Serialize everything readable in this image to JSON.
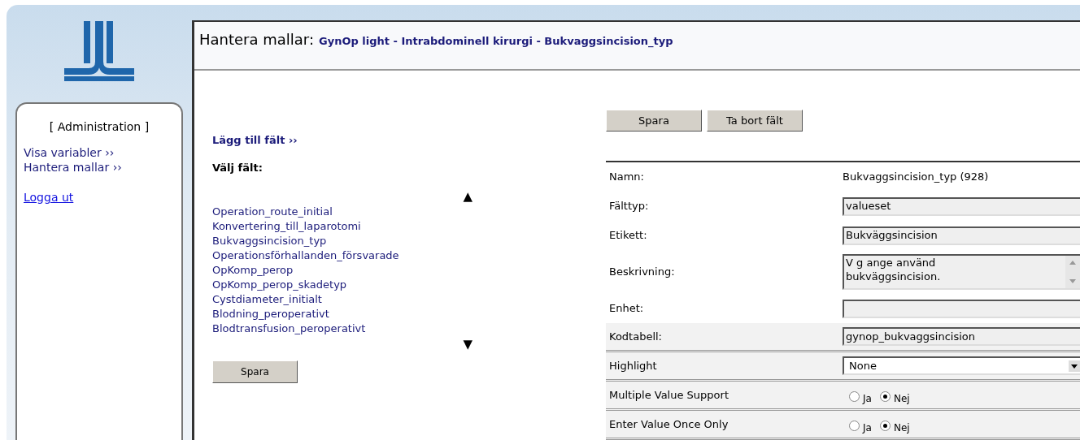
{
  "sidebar": {
    "heading": "[ Administration ]",
    "links": [
      {
        "label": "Visa variabler ››"
      },
      {
        "label": "Hantera mallar ››"
      }
    ],
    "logout": "Logga ut"
  },
  "header": {
    "title": "Hantera mallar:",
    "path": "GynOp light - Intrabdominell kirurgi - Bukvaggsincision_typ"
  },
  "left": {
    "add_link": "Lägg till fält ››",
    "choose_label": "Välj fält:",
    "up": "▲",
    "down": "▼",
    "fields": [
      {
        "label": "Operation_route_initial"
      },
      {
        "label": "Konvertering_till_laparotomi"
      },
      {
        "label": "Bukvaggsincision_typ"
      },
      {
        "label": "Operationsförhallanden_försvarade"
      },
      {
        "label": "OpKomp_perop"
      },
      {
        "label": "OpKomp_perop_skadetyp"
      },
      {
        "label": "Cystdiameter_initialt"
      },
      {
        "label": "Blodning_peroperativt"
      },
      {
        "label": "Blodtransfusion_peroperativt"
      }
    ],
    "save": "Spara"
  },
  "right": {
    "buttons": [
      "Spara",
      "Ta bort fält"
    ],
    "rows": [
      {
        "kind": "text",
        "label": "Namn:",
        "value": "Bukvaggsincision_typ (928)",
        "shaded": false
      },
      {
        "kind": "input",
        "label": "Fälttyp:",
        "value": "valueset",
        "shaded": false
      },
      {
        "kind": "input",
        "label": "Etikett:",
        "value": "Bukväggsincision",
        "shaded": false
      },
      {
        "kind": "textarea",
        "label": "Beskrivning:",
        "value": "V g ange använd bukväggsincision.",
        "shaded": false
      },
      {
        "kind": "input",
        "label": "Enhet:",
        "shaded": false
      },
      {
        "kind": "input",
        "label": "Kodtabell:",
        "value": "gynop_bukvaggsincision",
        "shaded": true
      },
      {
        "kind": "select",
        "label": "Highlight",
        "value": "None",
        "shaded": true
      },
      {
        "kind": "radio",
        "label": "Multiple Value Support",
        "shaded": true,
        "options": [
          {
            "label": "Ja",
            "selected": false
          },
          {
            "label": "Nej",
            "selected": true
          }
        ]
      },
      {
        "kind": "radio",
        "label": "Enter Value Once Only",
        "shaded": true,
        "options": [
          {
            "label": "Ja",
            "selected": false
          },
          {
            "label": "Nej",
            "selected": true
          }
        ]
      }
    ]
  }
}
